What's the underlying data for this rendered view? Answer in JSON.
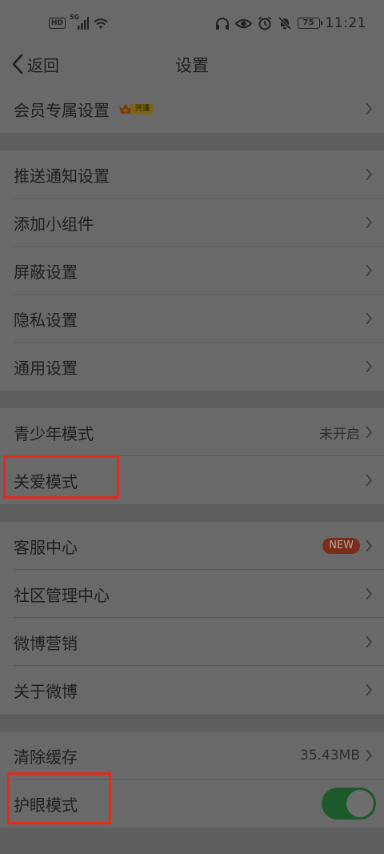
{
  "status_bar": {
    "hd": "HD",
    "network": "5G",
    "battery": "75",
    "time": "11:21"
  },
  "nav": {
    "back_label": "返回",
    "title": "设置"
  },
  "groups": [
    {
      "items": [
        {
          "label": "会员专属设置",
          "badge": "开通",
          "icon": "crown-icon"
        }
      ]
    },
    {
      "items": [
        {
          "label": "推送通知设置"
        },
        {
          "label": "添加小组件"
        },
        {
          "label": "屏蔽设置"
        },
        {
          "label": "隐私设置"
        },
        {
          "label": "通用设置"
        }
      ]
    },
    {
      "items": [
        {
          "label": "青少年模式",
          "value": "未开启"
        },
        {
          "label": "关爱模式"
        }
      ]
    },
    {
      "items": [
        {
          "label": "客服中心",
          "badge": "NEW"
        },
        {
          "label": "社区管理中心"
        },
        {
          "label": "微博营销"
        },
        {
          "label": "关于微博"
        }
      ]
    },
    {
      "items": [
        {
          "label": "清除缓存",
          "value": "35.43MB"
        },
        {
          "label": "护眼模式",
          "toggle": true,
          "toggle_on": true
        }
      ]
    }
  ],
  "colors": {
    "highlight": "#e52a1c",
    "toggle_on": "#1d5a2b",
    "new_badge": "#7a2d18"
  }
}
